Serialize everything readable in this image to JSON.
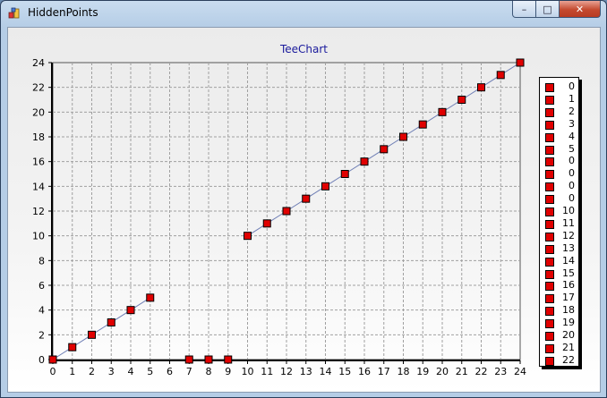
{
  "window": {
    "title": "HiddenPoints",
    "app_icon": "teechart-app-icon",
    "buttons": {
      "minimize": "–",
      "maximize": "□",
      "close": "✕"
    }
  },
  "chart_data": {
    "type": "line",
    "title": "TeeChart",
    "xlabel": "",
    "ylabel": "",
    "xlim": [
      0,
      24
    ],
    "ylim": [
      0,
      24
    ],
    "x_ticks": [
      0,
      1,
      2,
      3,
      4,
      5,
      6,
      7,
      8,
      9,
      10,
      11,
      12,
      13,
      14,
      15,
      16,
      17,
      18,
      19,
      20,
      21,
      22,
      23,
      24
    ],
    "y_ticks": [
      0,
      2,
      4,
      6,
      8,
      10,
      12,
      14,
      16,
      18,
      20,
      22,
      24
    ],
    "grid": true,
    "legend_position": "right",
    "colors": {
      "point_fill": "#e00000",
      "point_stroke": "#000000",
      "line": "#6f7fb5",
      "grid": "#a0a0a0"
    },
    "series": [
      {
        "points": [
          [
            0,
            0
          ],
          [
            1,
            1
          ],
          [
            2,
            2
          ],
          [
            3,
            3
          ],
          [
            4,
            4
          ],
          [
            5,
            5
          ],
          [
            7,
            0
          ],
          [
            8,
            0
          ],
          [
            9,
            0
          ],
          [
            10,
            10
          ],
          [
            11,
            11
          ],
          [
            12,
            12
          ],
          [
            13,
            13
          ],
          [
            14,
            14
          ],
          [
            15,
            15
          ],
          [
            16,
            16
          ],
          [
            17,
            17
          ],
          [
            18,
            18
          ],
          [
            19,
            19
          ],
          [
            20,
            20
          ],
          [
            21,
            21
          ],
          [
            22,
            22
          ],
          [
            23,
            23
          ],
          [
            24,
            24
          ]
        ],
        "line_segments": [
          [
            0,
            5
          ],
          [
            9,
            23
          ]
        ],
        "legend_labels": [
          "0",
          "1",
          "2",
          "3",
          "4",
          "5",
          "0",
          "0",
          "0",
          "0",
          "10",
          "11",
          "12",
          "13",
          "14",
          "15",
          "16",
          "17",
          "18",
          "19",
          "20",
          "21",
          "22"
        ]
      }
    ]
  }
}
